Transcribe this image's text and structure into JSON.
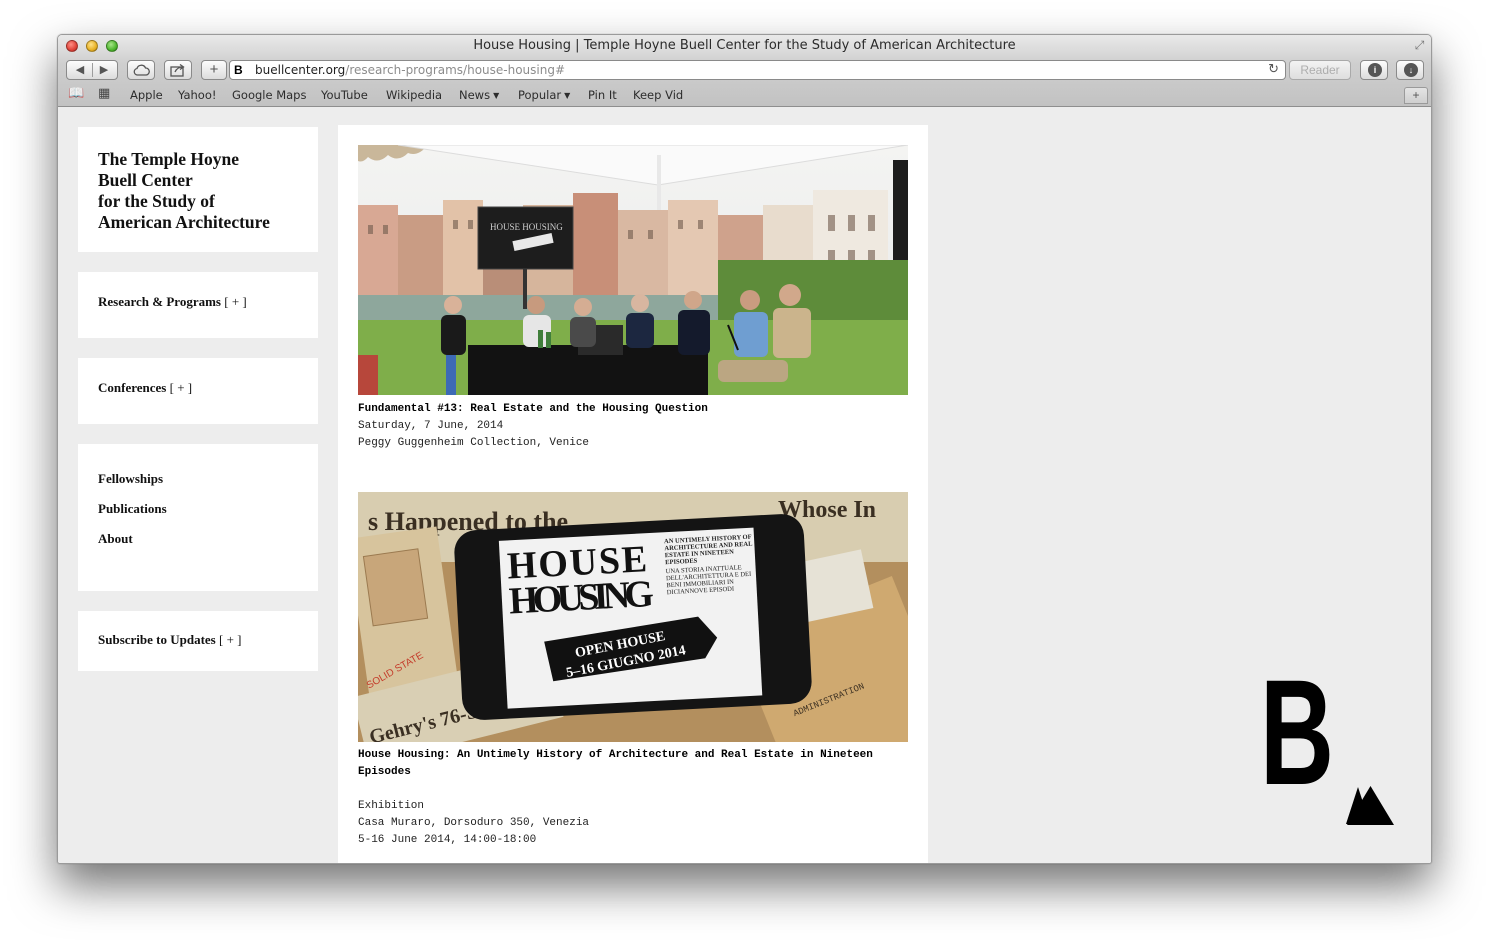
{
  "window": {
    "title": "House Housing | Temple Hoyne Buell Center for the Study of American Architecture"
  },
  "toolbar": {
    "back_icon": "◀",
    "forward_icon": "▶",
    "plus_label": "+",
    "reader_label": "Reader",
    "favicon_text": "B",
    "url_domain": "buellcenter.org",
    "url_path": "/research-programs/house-housing#"
  },
  "bookmarks": [
    {
      "label": "Apple"
    },
    {
      "label": "Yahoo!"
    },
    {
      "label": "Google Maps"
    },
    {
      "label": "YouTube"
    },
    {
      "label": "Wikipedia"
    },
    {
      "label": "News",
      "menu": true
    },
    {
      "label": "Popular",
      "menu": true
    },
    {
      "label": "Pin It"
    },
    {
      "label": "Keep Vid"
    }
  ],
  "sidebar": {
    "site_title": "The Temple Hoyne\nBuell Center\nfor the Study of\nAmerican Architecture",
    "research": {
      "label": "Research & Programs",
      "toggle": "[ + ]"
    },
    "conferences": {
      "label": "Conferences",
      "toggle": "[ + ]"
    },
    "links": [
      {
        "label": "Fellowships"
      },
      {
        "label": "Publications"
      },
      {
        "label": "About"
      }
    ],
    "subscribe": {
      "label": "Subscribe to Updates",
      "toggle": "[ + ]"
    }
  },
  "posts": [
    {
      "title": "Fundamental #13: Real Estate and the Housing Question",
      "lines": [
        "Saturday, 7 June, 2014",
        "Peggy Guggenheim Collection, Venice"
      ],
      "image": {
        "screen_title": "HOUSE HOUSING"
      }
    },
    {
      "title": "House Housing: An Untimely History of Architecture and Real Estate in Nineteen Episodes",
      "lines": [
        "",
        "Exhibition",
        "Casa Muraro, Dorsoduro 350, Venezia",
        "5-16 June 2014, 14:00-18:00"
      ],
      "image": {
        "headline_1": "HOUSE",
        "headline_2": "HOUSING",
        "subhead": "AN UNTIMELY HISTORY OF ARCHITECTURE AND REAL ESTATE IN NINETEEN EPISODES",
        "subhead_it": "UNA STORIA INATTUALE DELL'ARCHITETTURA E DEI BENI IMMOBILIARI IN DICIANNOVE EPISODI",
        "arrow_line_1": "OPEN HOUSE",
        "arrow_line_2": "5–16 GIUGNO 2014",
        "paper_1": "s Happened to the",
        "paper_2": "Whose In",
        "paper_3": "Gehry's 76-S",
        "paper_4": "SOLID STATE",
        "paper_5": "ADMINISTRATION"
      }
    }
  ],
  "brand": {
    "letter": "B"
  }
}
